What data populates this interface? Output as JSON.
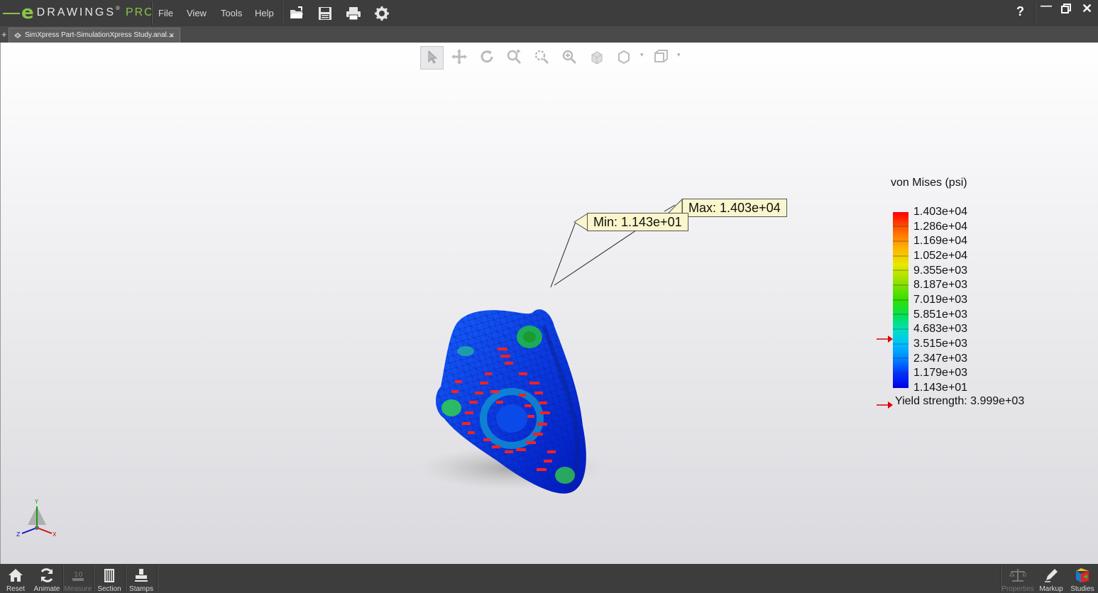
{
  "app": {
    "logo_text": "DRAWINGS",
    "logo_pro": "PRO",
    "logo_e": "e",
    "reg_mark": "®"
  },
  "menu": [
    "File",
    "View",
    "Tools",
    "Help"
  ],
  "toolbar_icons": [
    "open-icon",
    "save-icon",
    "print-icon",
    "settings-icon"
  ],
  "window_controls": {
    "help": "?",
    "minimize": "—",
    "restore": "🗗",
    "close": "✕"
  },
  "tab": {
    "plus": "+",
    "label": "SimXpress Part-SimulationXpress Study.anal...",
    "close": "×"
  },
  "legend": {
    "title": "von Mises (psi)",
    "values": [
      "1.403e+04",
      "1.286e+04",
      "1.169e+04",
      "1.052e+04",
      "9.355e+03",
      "8.187e+03",
      "7.019e+03",
      "5.851e+03",
      "4.683e+03",
      "3.515e+03",
      "2.347e+03",
      "1.179e+03",
      "1.143e+01"
    ],
    "yield": "Yield strength: 3.999e+03",
    "colors": {
      "high": "#ff0000",
      "mid": "#30e000",
      "low": "#0000e0",
      "marker": "#e00000"
    }
  },
  "callouts": {
    "max": "Max: 1.403e+04",
    "min": "Min: 1.143e+01"
  },
  "triad": {
    "y": "Y",
    "x": "X",
    "z": "Z"
  },
  "bottom_left": [
    {
      "label": "Reset",
      "icon": "home-icon",
      "enabled": true
    },
    {
      "label": "Animate",
      "icon": "animate-icon",
      "enabled": true
    },
    {
      "label": "Measure",
      "icon": "measure-icon",
      "enabled": false
    },
    {
      "label": "Section",
      "icon": "section-icon",
      "enabled": true
    },
    {
      "label": "Stamps",
      "icon": "stamps-icon",
      "enabled": true
    }
  ],
  "bottom_right": [
    {
      "label": "Properties",
      "icon": "properties-icon",
      "enabled": false
    },
    {
      "label": "Markup",
      "icon": "markup-icon",
      "enabled": true
    },
    {
      "label": "Studies",
      "icon": "studies-icon",
      "enabled": true
    }
  ]
}
